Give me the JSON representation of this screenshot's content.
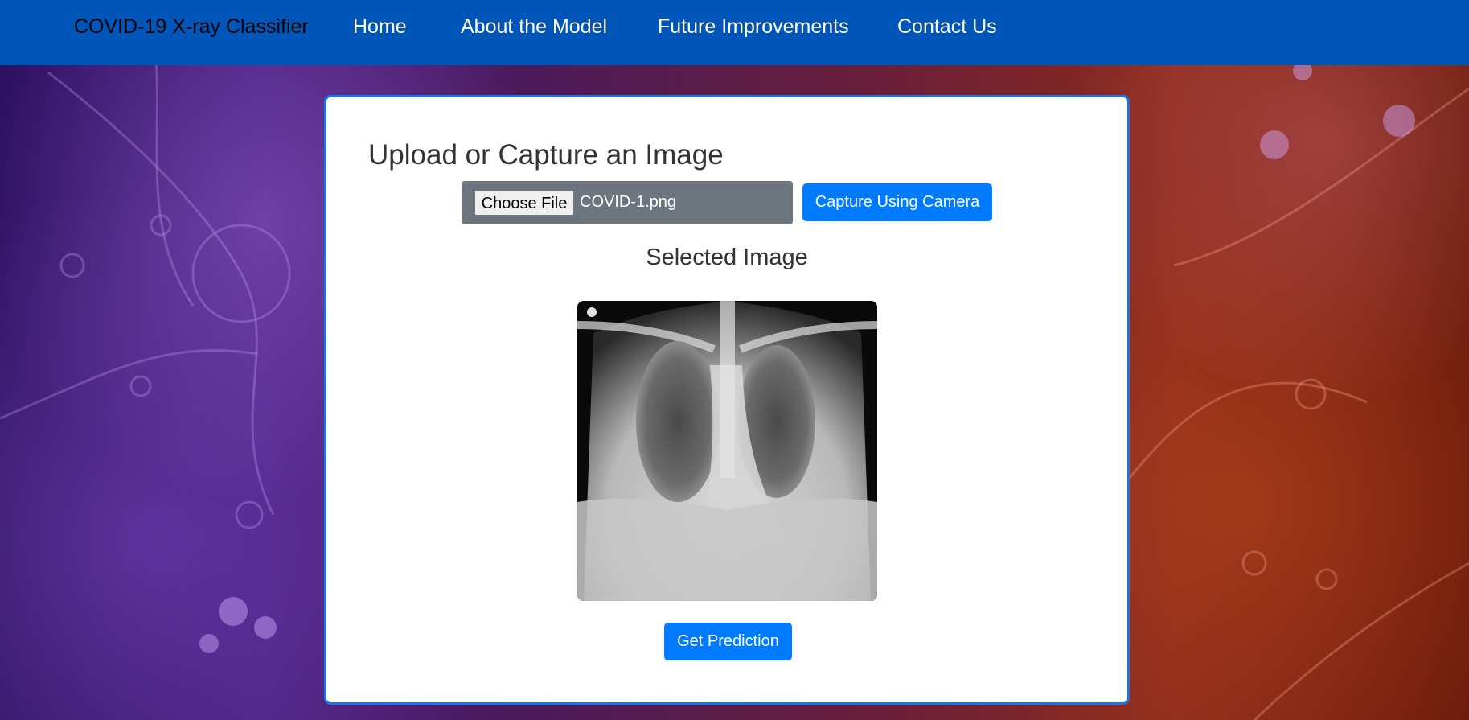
{
  "navbar": {
    "brand": "COVID-19 X-ray Classifier",
    "items": [
      {
        "label": "Home"
      },
      {
        "label": "About the Model"
      },
      {
        "label": "Future Improvements"
      },
      {
        "label": "Contact Us"
      }
    ],
    "background_color": "#0056b8"
  },
  "upload_card": {
    "title": "Upload or Capture an Image",
    "choose_file_label": "Choose File",
    "file_name": "COVID-1.png",
    "capture_button_label": "Capture Using Camera",
    "selected_image_title": "Selected Image",
    "predict_button_label": "Get Prediction",
    "accent_color": "#007bff"
  }
}
